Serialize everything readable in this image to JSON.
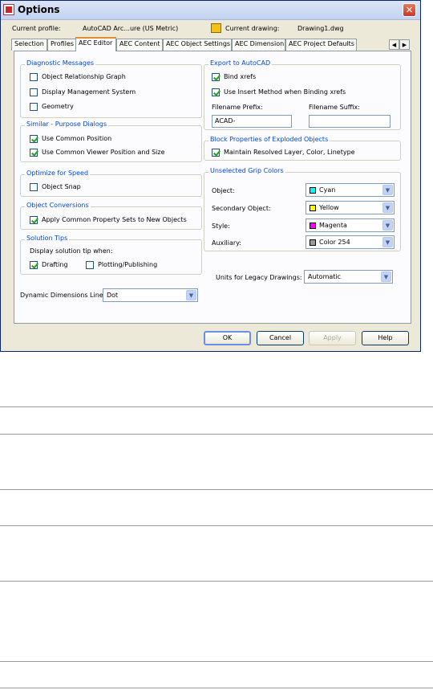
{
  "window": {
    "title": "Options",
    "close": "✕"
  },
  "header": {
    "profile_label": "Current profile:",
    "profile_value": "AutoCAD Arc...ure (US Metric)",
    "drawing_label": "Current drawing:",
    "drawing_value": "Drawing1.dwg"
  },
  "tabs": [
    "Selection",
    "Profiles",
    "AEC Editor",
    "AEC Content",
    "AEC Object Settings",
    "AEC Dimension",
    "AEC Project Defaults"
  ],
  "tab_scroll": {
    "left": "◀",
    "right": "▶"
  },
  "diagnostic": {
    "title": "Diagnostic Messages",
    "items": [
      "Object Relationship Graph",
      "Display Management System",
      "Geometry"
    ]
  },
  "similar": {
    "title": "Similar - Purpose Dialogs",
    "items": [
      "Use Common Position",
      "Use Common Viewer Position and Size"
    ]
  },
  "optimize": {
    "title": "Optimize for Speed",
    "items": [
      "Object Snap"
    ]
  },
  "conversions": {
    "title": "Object Conversions",
    "items": [
      "Apply Common Property Sets to New Objects"
    ]
  },
  "tips": {
    "title": "Solution Tips",
    "text": "Display solution tip when:",
    "items": [
      "Drafting",
      "Plotting/Publishing"
    ]
  },
  "linetype": {
    "label": "Dynamic Dimensions Linetype:",
    "value": "Dot"
  },
  "export": {
    "title": "Export to AutoCAD",
    "items": [
      "Bind xrefs",
      "Use Insert Method when Binding xrefs"
    ],
    "prefix_label": "Filename Prefix:",
    "prefix_value": "ACAD-",
    "suffix_label": "Filename Suffix:",
    "suffix_value": ""
  },
  "exploded": {
    "title": "Block Properties of Exploded Objects",
    "items": [
      "Maintain Resolved Layer, Color, Linetype"
    ]
  },
  "grip": {
    "title": "Unselected Grip Colors",
    "rows": [
      {
        "label": "Object:",
        "value": "Cyan",
        "color": "#00ffff"
      },
      {
        "label": "Secondary Object:",
        "value": "Yellow",
        "color": "#ffff00"
      },
      {
        "label": "Style:",
        "value": "Magenta",
        "color": "#ff00ff"
      },
      {
        "label": "Auxiliary:",
        "value": "Color 254",
        "color": "#9a9a9a"
      }
    ]
  },
  "legacy": {
    "label": "Units for Legacy Drawings:",
    "value": "Automatic"
  },
  "buttons": {
    "ok": "OK",
    "cancel": "Cancel",
    "apply": "Apply",
    "help": "Help"
  },
  "icons": {
    "dropdown": "▼"
  }
}
